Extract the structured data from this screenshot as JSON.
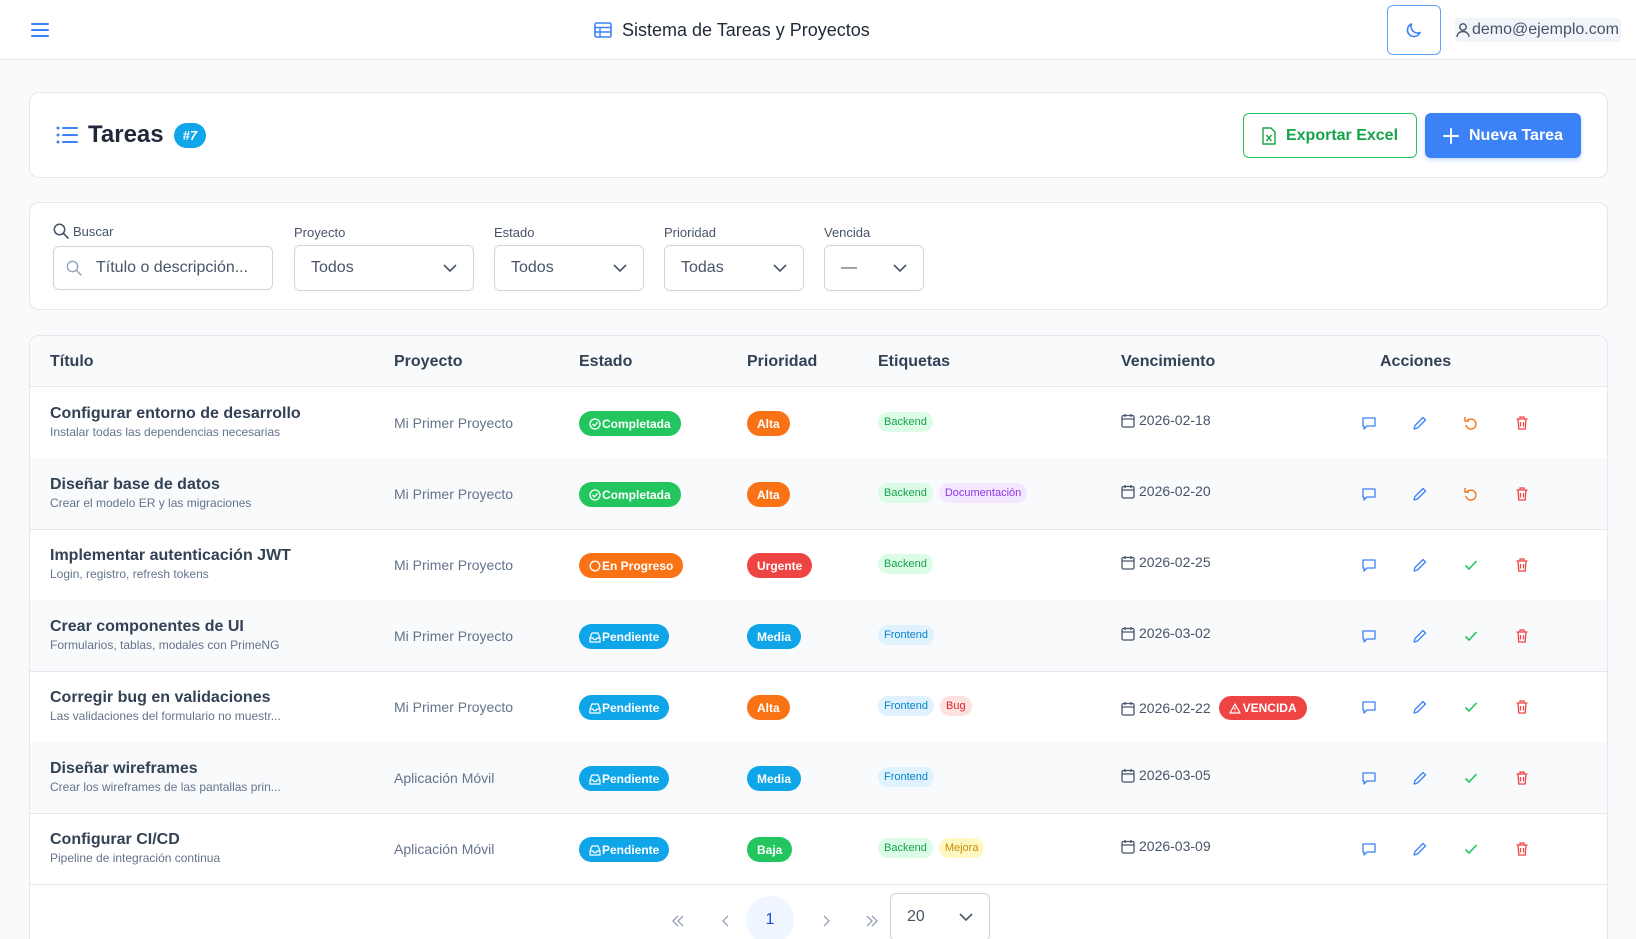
{
  "app": {
    "title": "Sistema de Tareas y Proyectos",
    "user_email": "demo@ejemplo.com"
  },
  "header": {
    "title": "Tareas",
    "count_badge": "#7",
    "export_label": "Exportar Excel",
    "new_label": "Nueva Tarea"
  },
  "filters": {
    "search_label": "Buscar",
    "search_placeholder": "Título o descripción...",
    "project_label": "Proyecto",
    "project_value": "Todos",
    "status_label": "Estado",
    "status_value": "Todos",
    "priority_label": "Prioridad",
    "priority_value": "Todas",
    "overdue_label": "Vencida",
    "overdue_value": "—"
  },
  "table": {
    "columns": [
      "Título",
      "Proyecto",
      "Estado",
      "Prioridad",
      "Etiquetas",
      "Vencimiento",
      "Acciones"
    ],
    "rows": [
      {
        "title": "Configurar entorno de desarrollo",
        "desc": "Instalar todas las dependencias necesarias",
        "project": "Mi Primer Proyecto",
        "status": "Completada",
        "priority": "Alta",
        "tags": [
          "Backend"
        ],
        "due": "2026-02-18",
        "overdue": ""
      },
      {
        "title": "Diseñar base de datos",
        "desc": "Crear el modelo ER y las migraciones",
        "project": "Mi Primer Proyecto",
        "status": "Completada",
        "priority": "Alta",
        "tags": [
          "Backend",
          "Documentación"
        ],
        "due": "2026-02-20",
        "overdue": ""
      },
      {
        "title": "Implementar autenticación JWT",
        "desc": "Login, registro, refresh tokens",
        "project": "Mi Primer Proyecto",
        "status": "En Progreso",
        "priority": "Urgente",
        "tags": [
          "Backend"
        ],
        "due": "2026-02-25",
        "overdue": ""
      },
      {
        "title": "Crear componentes de UI",
        "desc": "Formularios, tablas, modales con PrimeNG",
        "project": "Mi Primer Proyecto",
        "status": "Pendiente",
        "priority": "Media",
        "tags": [
          "Frontend"
        ],
        "due": "2026-03-02",
        "overdue": ""
      },
      {
        "title": "Corregir bug en validaciones",
        "desc": "Las validaciones del formulario no muestr...",
        "project": "Mi Primer Proyecto",
        "status": "Pendiente",
        "priority": "Alta",
        "tags": [
          "Frontend",
          "Bug"
        ],
        "due": "2026-02-22",
        "overdue": "VENCIDA"
      },
      {
        "title": "Diseñar wireframes",
        "desc": "Crear los wireframes de las pantallas prin...",
        "project": "Aplicación Móvil",
        "status": "Pendiente",
        "priority": "Media",
        "tags": [
          "Frontend"
        ],
        "due": "2026-03-05",
        "overdue": ""
      },
      {
        "title": "Configurar CI/CD",
        "desc": "Pipeline de integración continua",
        "project": "Aplicación Móvil",
        "status": "Pendiente",
        "priority": "Baja",
        "tags": [
          "Backend",
          "Mejora"
        ],
        "due": "2026-03-09",
        "overdue": ""
      }
    ]
  },
  "pagination": {
    "current_page": "1",
    "page_size": "20"
  },
  "colors": {
    "primary": "#3b82f6",
    "success": "#22c55e",
    "warning": "#f97316",
    "danger": "#ef4444",
    "info": "#0ea5e9",
    "status": {
      "Completada": "#22c55e",
      "En Progreso": "#f97316",
      "Pendiente": "#0ea5e9"
    },
    "priority": {
      "Alta": "#f97316",
      "Urgente": "#ef4444",
      "Media": "#0ea5e9",
      "Baja": "#22c55e"
    },
    "tags": {
      "Backend": [
        "#dcfce7",
        "#16a34a"
      ],
      "Frontend": [
        "#e0f2fe",
        "#0284c7"
      ],
      "Documentación": [
        "#f3e8ff",
        "#9333ea"
      ],
      "Bug": [
        "#fee2e2",
        "#dc2626"
      ],
      "Mejora": [
        "#fef9c3",
        "#ca8a04"
      ]
    }
  }
}
